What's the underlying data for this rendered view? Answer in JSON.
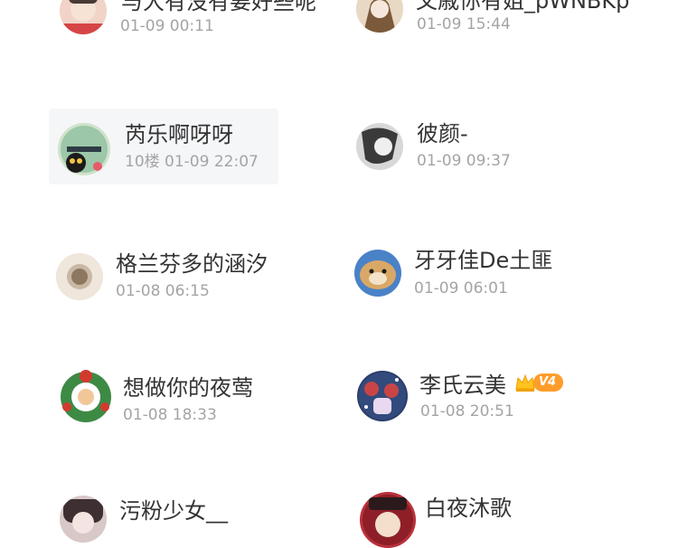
{
  "users": [
    {
      "name": "与大有没有要好些呢",
      "meta": "01-09 00:11",
      "avatar": "avatar-photo-child",
      "color": "#f2d3c7"
    },
    {
      "name": "文戚你有姐_pWNBKp",
      "meta": "01-09 15:44",
      "avatar": "avatar-anime-girl",
      "color": "#e9d8c4"
    },
    {
      "name": "芮乐啊呀呀",
      "meta": "10楼 01-09 22:07",
      "avatar": "avatar-cartoon-cat",
      "color": "#cfe3c9",
      "highlighted": true
    },
    {
      "name": "彼颜-",
      "meta": "01-09 09:37",
      "avatar": "avatar-bw-sketch",
      "color": "#cfcfcf"
    },
    {
      "name": "格兰芬多的涵汐",
      "meta": "01-08 06:15",
      "avatar": "avatar-crest",
      "color": "#efe6dc"
    },
    {
      "name": "牙牙佳De土匪",
      "meta": "01-09 06:01",
      "avatar": "avatar-dog",
      "color": "#d9b27a"
    },
    {
      "name": "想做你的夜莺",
      "meta": "01-08 18:33",
      "avatar": "avatar-christmas-wreath",
      "color": "#3d8a45"
    },
    {
      "name": "李氏云美",
      "meta": "01-08 20:51",
      "avatar": "avatar-anime-pair",
      "color": "#2c3e6b",
      "badge": {
        "icon": "crown-icon",
        "level": "V4",
        "color": "#ff9d2b"
      }
    },
    {
      "name": "污粉少女__",
      "meta": "",
      "avatar": "avatar-girl-photo",
      "color": "#d8c8c8"
    },
    {
      "name": "白夜沐歌",
      "meta": "",
      "avatar": "avatar-anime-red",
      "color": "#b9303a"
    }
  ]
}
